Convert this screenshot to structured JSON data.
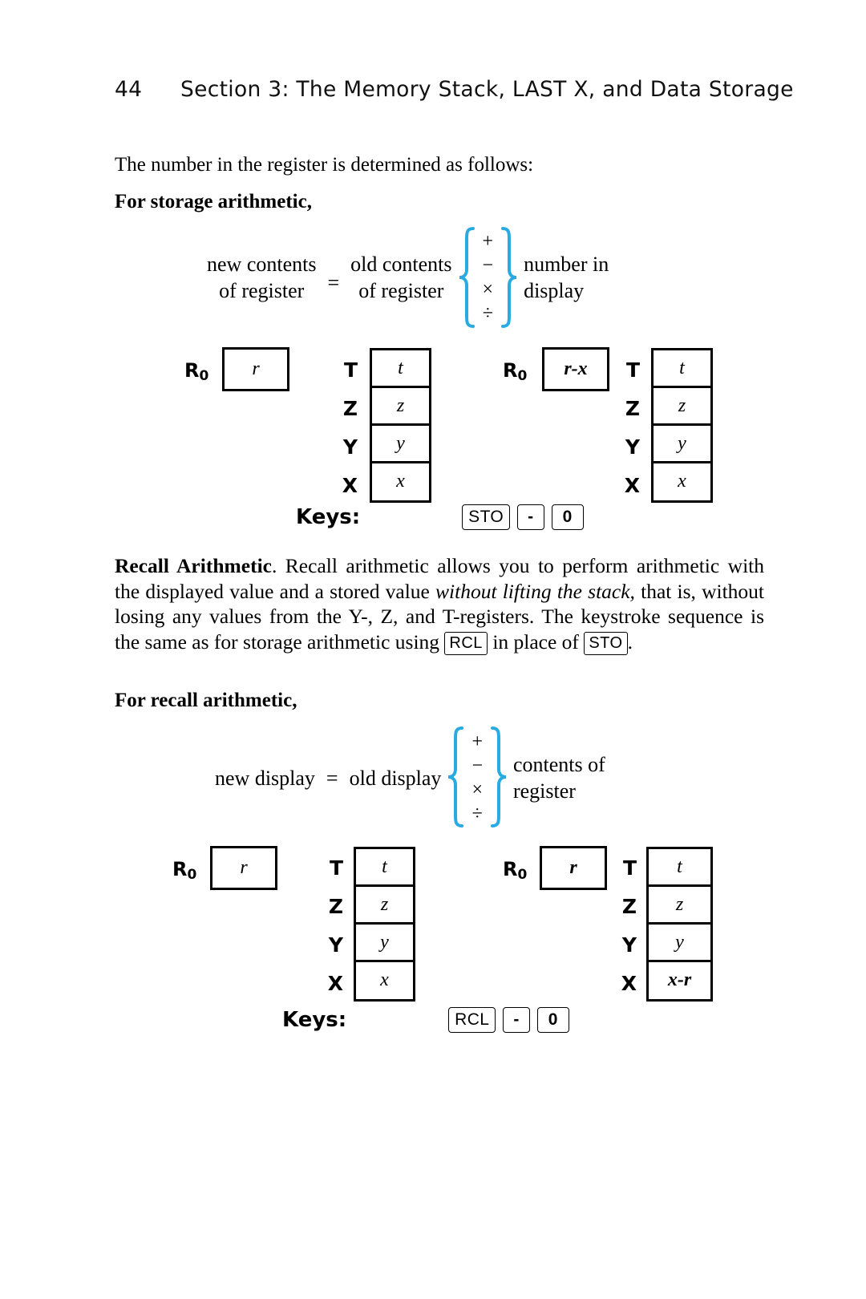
{
  "page": {
    "number": "44",
    "running_head": "Section 3: The Memory Stack, LAST X, and Data Storage"
  },
  "intro": {
    "text": "The number in the register is determined as follows:"
  },
  "headings": {
    "storage": "For storage arithmetic,",
    "recall": "For recall arithmetic,"
  },
  "equations": {
    "storage": {
      "left_line1": "new contents",
      "left_line2": "of register",
      "equals": "=",
      "right_line1": "old contents",
      "right_line2": "of register",
      "operators": [
        "+",
        "−",
        "×",
        "÷"
      ],
      "tail_line1": "number in",
      "tail_line2": "display",
      "brace_color": "#29ABE2"
    },
    "recall": {
      "left_line1": "new display",
      "left_line2": "",
      "equals": "=",
      "right_line1": "old display",
      "right_line2": "",
      "operators": [
        "+",
        "−",
        "×",
        "÷"
      ],
      "tail_line1": "contents of",
      "tail_line2": "register",
      "brace_color": "#29ABE2"
    }
  },
  "recall_paragraph": {
    "lead": "Recall Arithmetic",
    "part1": ". Recall arithmetic allows you to perform arithmetic with the displayed value and a stored value ",
    "italic": "without lifting the stack,",
    "part2": " that is, without losing any values from the Y-, Z, and T-registers. The keystroke sequence is the same as for storage arithmetic using ",
    "key_rcl": "RCL",
    "part3": " in place of ",
    "key_sto": "STO",
    "part4": "."
  },
  "diagrams": {
    "storage": {
      "before": {
        "register_label": "R",
        "register_subscript": "0",
        "register_value": "r",
        "register_bold": false,
        "stack_labels": [
          "T",
          "Z",
          "Y",
          "X"
        ],
        "stack_values": [
          "t",
          "z",
          "y",
          "x"
        ],
        "stack_bold": [
          false,
          false,
          false,
          false
        ]
      },
      "after": {
        "register_label": "R",
        "register_subscript": "0",
        "register_value": "r-x",
        "register_bold": true,
        "stack_labels": [
          "T",
          "Z",
          "Y",
          "X"
        ],
        "stack_values": [
          "t",
          "z",
          "y",
          "x"
        ],
        "stack_bold": [
          false,
          false,
          false,
          false
        ]
      },
      "keys_label": "Keys:",
      "keys": [
        "STO",
        "-",
        "0"
      ]
    },
    "recall": {
      "before": {
        "register_label": "R",
        "register_subscript": "0",
        "register_value": "r",
        "register_bold": false,
        "stack_labels": [
          "T",
          "Z",
          "Y",
          "X"
        ],
        "stack_values": [
          "t",
          "z",
          "y",
          "x"
        ],
        "stack_bold": [
          false,
          false,
          false,
          false
        ]
      },
      "after": {
        "register_label": "R",
        "register_subscript": "0",
        "register_value": "r",
        "register_bold": true,
        "stack_labels": [
          "T",
          "Z",
          "Y",
          "X"
        ],
        "stack_values": [
          "t",
          "z",
          "y",
          "x-r"
        ],
        "stack_bold": [
          false,
          false,
          false,
          true
        ]
      },
      "keys_label": "Keys:",
      "keys": [
        "RCL",
        "-",
        "0"
      ]
    }
  }
}
